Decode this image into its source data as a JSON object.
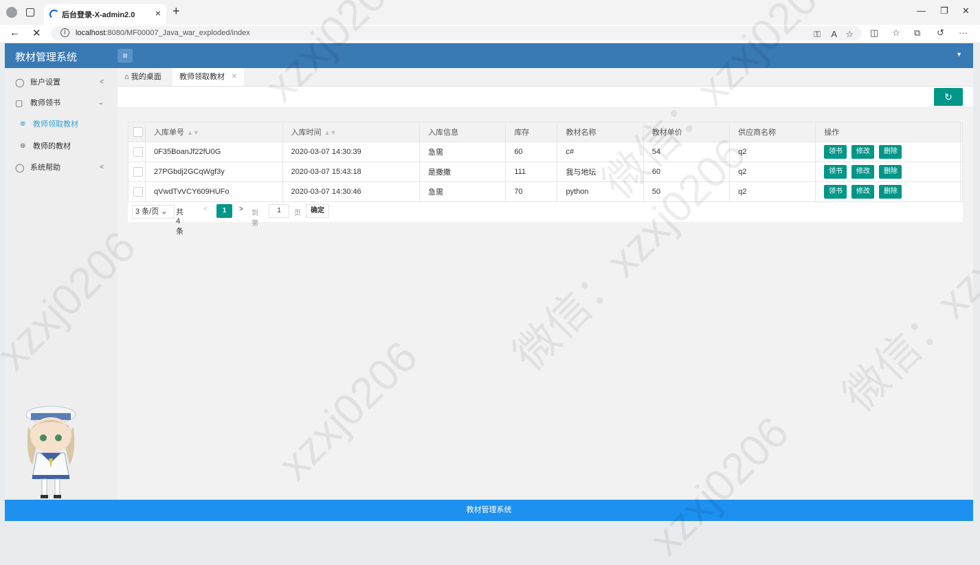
{
  "browser": {
    "tab_title": "后台登录-X-admin2.0",
    "url_host": "localhost",
    "url_rest": ":8080/MF00007_Java_war_exploded/index"
  },
  "app": {
    "logo": "教材管理系统",
    "footer": "教材管理系统"
  },
  "sidebar": {
    "items": [
      {
        "label": "账户设置",
        "icon": "user-icon",
        "arrow": "<"
      },
      {
        "label": "教师领书",
        "icon": "box-icon",
        "arrow": "v"
      },
      {
        "label": "系统帮助",
        "icon": "user-icon",
        "arrow": "<"
      }
    ],
    "subitems": [
      {
        "label": "教师领取教材",
        "icon": "circle-icon",
        "active": true
      },
      {
        "label": "教师的教材",
        "icon": "circle-icon",
        "active": false
      }
    ]
  },
  "page_tabs": {
    "home": "我的桌面",
    "current": "教师领取教材"
  },
  "table": {
    "headers": [
      "入库单号",
      "入库时间",
      "入库信息",
      "库存",
      "教材名称",
      "教材单价",
      "供应商名称",
      "操作"
    ],
    "rows": [
      {
        "id": "0F35BoanJf22fU0G",
        "time": "2020-03-07 14:30:39",
        "info": "急需",
        "stock": "60",
        "name": "c#",
        "price": "54",
        "supplier": "q2"
      },
      {
        "id": "27PGbdj2GCqWgf3y",
        "time": "2020-03-07 15:43:18",
        "info": "是撒撒",
        "stock": "111",
        "name": "我与地坛",
        "price": "60",
        "supplier": "q2"
      },
      {
        "id": "qVwdTvVCY609HUFo",
        "time": "2020-03-07 14:30:46",
        "info": "急需",
        "stock": "70",
        "name": "python",
        "price": "50",
        "supplier": "q2"
      }
    ],
    "actions": [
      "领书",
      "修改",
      "删除"
    ]
  },
  "pager": {
    "limit": "3 条/页",
    "count": "共 4 条",
    "current_page": "1",
    "goto_label": "到第",
    "goto_value": "1",
    "page_label": "页",
    "confirm": "确定"
  },
  "watermarks": [
    "xzxj0206",
    "微信：xzxj0206"
  ],
  "colors": {
    "header": "#3979b4",
    "accent": "#009688",
    "footer": "#1e90ef"
  }
}
